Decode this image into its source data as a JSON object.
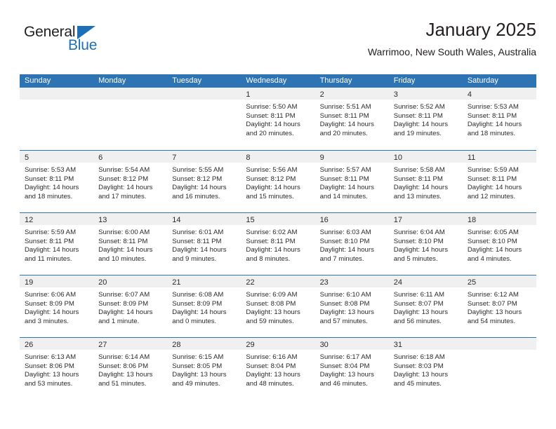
{
  "logo": {
    "word_top": "General",
    "word_bottom": "Blue",
    "triangle_icon": "blue-triangle-icon",
    "accent_color": "#1d70b8"
  },
  "header": {
    "month_title": "January 2025",
    "location": "Warrimoo, New South Wales, Australia"
  },
  "calendar": {
    "header_color": "#2e74b5",
    "daynum_band_color": "#f0f0f0",
    "day_headers": [
      "Sunday",
      "Monday",
      "Tuesday",
      "Wednesday",
      "Thursday",
      "Friday",
      "Saturday"
    ],
    "weeks": [
      [
        {
          "day": "",
          "lines": []
        },
        {
          "day": "",
          "lines": []
        },
        {
          "day": "",
          "lines": []
        },
        {
          "day": "1",
          "lines": [
            "Sunrise: 5:50 AM",
            "Sunset: 8:11 PM",
            "Daylight: 14 hours",
            "and 20 minutes."
          ]
        },
        {
          "day": "2",
          "lines": [
            "Sunrise: 5:51 AM",
            "Sunset: 8:11 PM",
            "Daylight: 14 hours",
            "and 20 minutes."
          ]
        },
        {
          "day": "3",
          "lines": [
            "Sunrise: 5:52 AM",
            "Sunset: 8:11 PM",
            "Daylight: 14 hours",
            "and 19 minutes."
          ]
        },
        {
          "day": "4",
          "lines": [
            "Sunrise: 5:53 AM",
            "Sunset: 8:11 PM",
            "Daylight: 14 hours",
            "and 18 minutes."
          ]
        }
      ],
      [
        {
          "day": "5",
          "lines": [
            "Sunrise: 5:53 AM",
            "Sunset: 8:11 PM",
            "Daylight: 14 hours",
            "and 18 minutes."
          ]
        },
        {
          "day": "6",
          "lines": [
            "Sunrise: 5:54 AM",
            "Sunset: 8:12 PM",
            "Daylight: 14 hours",
            "and 17 minutes."
          ]
        },
        {
          "day": "7",
          "lines": [
            "Sunrise: 5:55 AM",
            "Sunset: 8:12 PM",
            "Daylight: 14 hours",
            "and 16 minutes."
          ]
        },
        {
          "day": "8",
          "lines": [
            "Sunrise: 5:56 AM",
            "Sunset: 8:12 PM",
            "Daylight: 14 hours",
            "and 15 minutes."
          ]
        },
        {
          "day": "9",
          "lines": [
            "Sunrise: 5:57 AM",
            "Sunset: 8:11 PM",
            "Daylight: 14 hours",
            "and 14 minutes."
          ]
        },
        {
          "day": "10",
          "lines": [
            "Sunrise: 5:58 AM",
            "Sunset: 8:11 PM",
            "Daylight: 14 hours",
            "and 13 minutes."
          ]
        },
        {
          "day": "11",
          "lines": [
            "Sunrise: 5:59 AM",
            "Sunset: 8:11 PM",
            "Daylight: 14 hours",
            "and 12 minutes."
          ]
        }
      ],
      [
        {
          "day": "12",
          "lines": [
            "Sunrise: 5:59 AM",
            "Sunset: 8:11 PM",
            "Daylight: 14 hours",
            "and 11 minutes."
          ]
        },
        {
          "day": "13",
          "lines": [
            "Sunrise: 6:00 AM",
            "Sunset: 8:11 PM",
            "Daylight: 14 hours",
            "and 10 minutes."
          ]
        },
        {
          "day": "14",
          "lines": [
            "Sunrise: 6:01 AM",
            "Sunset: 8:11 PM",
            "Daylight: 14 hours",
            "and 9 minutes."
          ]
        },
        {
          "day": "15",
          "lines": [
            "Sunrise: 6:02 AM",
            "Sunset: 8:11 PM",
            "Daylight: 14 hours",
            "and 8 minutes."
          ]
        },
        {
          "day": "16",
          "lines": [
            "Sunrise: 6:03 AM",
            "Sunset: 8:10 PM",
            "Daylight: 14 hours",
            "and 7 minutes."
          ]
        },
        {
          "day": "17",
          "lines": [
            "Sunrise: 6:04 AM",
            "Sunset: 8:10 PM",
            "Daylight: 14 hours",
            "and 5 minutes."
          ]
        },
        {
          "day": "18",
          "lines": [
            "Sunrise: 6:05 AM",
            "Sunset: 8:10 PM",
            "Daylight: 14 hours",
            "and 4 minutes."
          ]
        }
      ],
      [
        {
          "day": "19",
          "lines": [
            "Sunrise: 6:06 AM",
            "Sunset: 8:09 PM",
            "Daylight: 14 hours",
            "and 3 minutes."
          ]
        },
        {
          "day": "20",
          "lines": [
            "Sunrise: 6:07 AM",
            "Sunset: 8:09 PM",
            "Daylight: 14 hours",
            "and 1 minute."
          ]
        },
        {
          "day": "21",
          "lines": [
            "Sunrise: 6:08 AM",
            "Sunset: 8:09 PM",
            "Daylight: 14 hours",
            "and 0 minutes."
          ]
        },
        {
          "day": "22",
          "lines": [
            "Sunrise: 6:09 AM",
            "Sunset: 8:08 PM",
            "Daylight: 13 hours",
            "and 59 minutes."
          ]
        },
        {
          "day": "23",
          "lines": [
            "Sunrise: 6:10 AM",
            "Sunset: 8:08 PM",
            "Daylight: 13 hours",
            "and 57 minutes."
          ]
        },
        {
          "day": "24",
          "lines": [
            "Sunrise: 6:11 AM",
            "Sunset: 8:07 PM",
            "Daylight: 13 hours",
            "and 56 minutes."
          ]
        },
        {
          "day": "25",
          "lines": [
            "Sunrise: 6:12 AM",
            "Sunset: 8:07 PM",
            "Daylight: 13 hours",
            "and 54 minutes."
          ]
        }
      ],
      [
        {
          "day": "26",
          "lines": [
            "Sunrise: 6:13 AM",
            "Sunset: 8:06 PM",
            "Daylight: 13 hours",
            "and 53 minutes."
          ]
        },
        {
          "day": "27",
          "lines": [
            "Sunrise: 6:14 AM",
            "Sunset: 8:06 PM",
            "Daylight: 13 hours",
            "and 51 minutes."
          ]
        },
        {
          "day": "28",
          "lines": [
            "Sunrise: 6:15 AM",
            "Sunset: 8:05 PM",
            "Daylight: 13 hours",
            "and 49 minutes."
          ]
        },
        {
          "day": "29",
          "lines": [
            "Sunrise: 6:16 AM",
            "Sunset: 8:04 PM",
            "Daylight: 13 hours",
            "and 48 minutes."
          ]
        },
        {
          "day": "30",
          "lines": [
            "Sunrise: 6:17 AM",
            "Sunset: 8:04 PM",
            "Daylight: 13 hours",
            "and 46 minutes."
          ]
        },
        {
          "day": "31",
          "lines": [
            "Sunrise: 6:18 AM",
            "Sunset: 8:03 PM",
            "Daylight: 13 hours",
            "and 45 minutes."
          ]
        },
        {
          "day": "",
          "lines": []
        }
      ]
    ]
  }
}
